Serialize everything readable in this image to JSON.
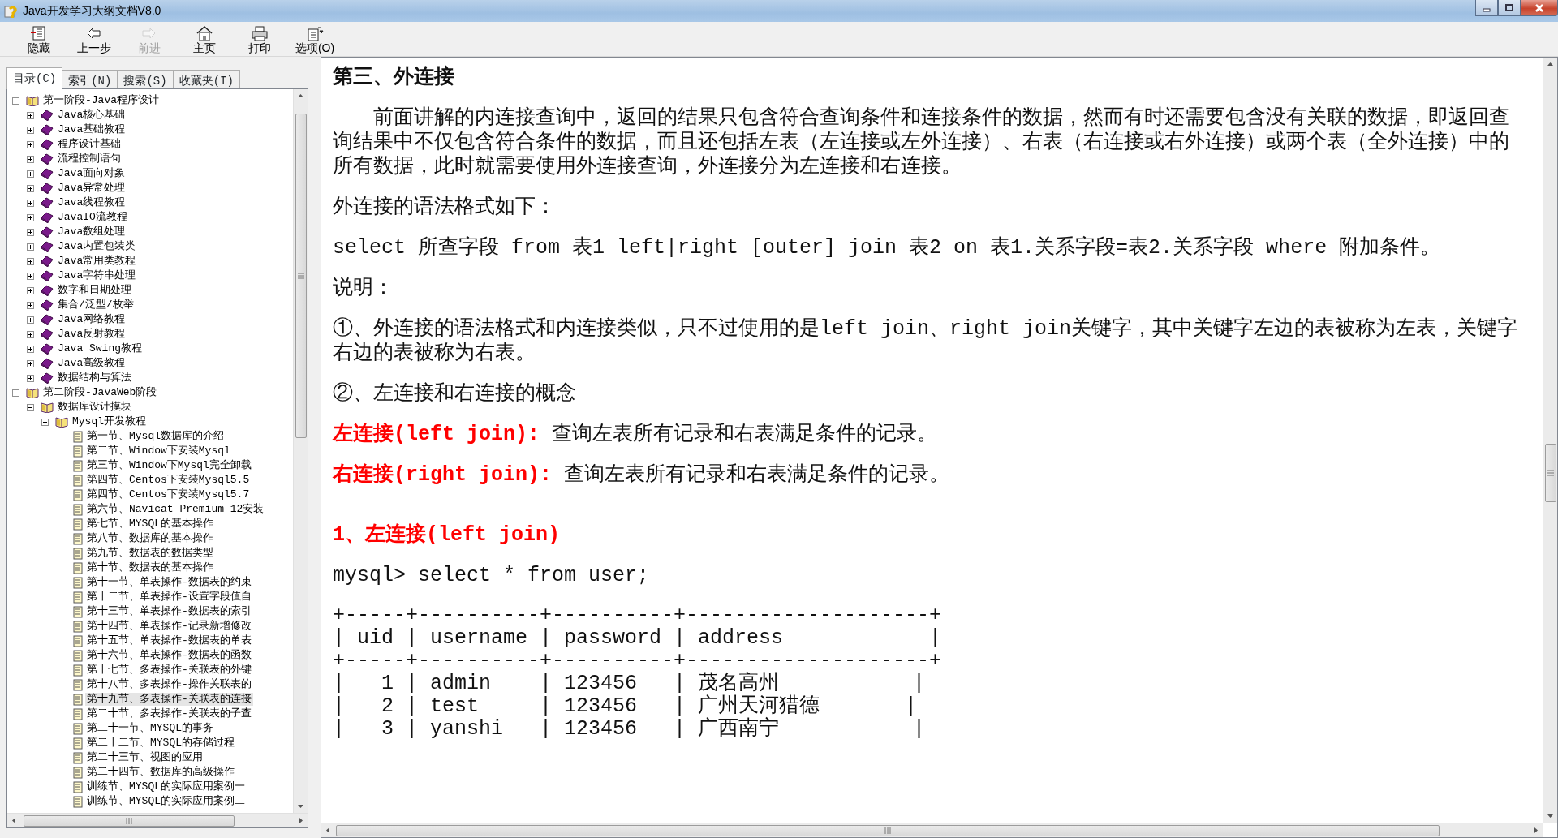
{
  "window": {
    "title": "Java开发学习大纲文档V8.0"
  },
  "toolbar": [
    {
      "label": "隐藏",
      "kind": "hide",
      "disabled": false
    },
    {
      "label": "上一步",
      "kind": "back",
      "disabled": false
    },
    {
      "label": "前进",
      "kind": "forward",
      "disabled": true
    },
    {
      "label": "主页",
      "kind": "home",
      "disabled": false
    },
    {
      "label": "打印",
      "kind": "print",
      "disabled": false
    },
    {
      "label": "选项(O)",
      "kind": "options",
      "disabled": false
    }
  ],
  "tabs": [
    {
      "label": "目录(C)",
      "selected": true
    },
    {
      "label": "索引(N)",
      "selected": false
    },
    {
      "label": "搜索(S)",
      "selected": false
    },
    {
      "label": "收藏夹(I)",
      "selected": false
    }
  ],
  "tree": [
    {
      "kind": "book",
      "label": "第一阶段-Java程序设计",
      "expanded": true,
      "children": [
        {
          "kind": "book",
          "label": "Java核心基础",
          "expanded": false
        },
        {
          "kind": "book",
          "label": "Java基础教程",
          "expanded": false
        },
        {
          "kind": "book",
          "label": "程序设计基础",
          "expanded": false
        },
        {
          "kind": "book",
          "label": "流程控制语句",
          "expanded": false
        },
        {
          "kind": "book",
          "label": "Java面向对象",
          "expanded": false
        },
        {
          "kind": "book",
          "label": "Java异常处理",
          "expanded": false
        },
        {
          "kind": "book",
          "label": "Java线程教程",
          "expanded": false
        },
        {
          "kind": "book",
          "label": "JavaIO流教程",
          "expanded": false
        },
        {
          "kind": "book",
          "label": "Java数组处理",
          "expanded": false
        },
        {
          "kind": "book",
          "label": "Java内置包装类",
          "expanded": false
        },
        {
          "kind": "book",
          "label": "Java常用类教程",
          "expanded": false
        },
        {
          "kind": "book",
          "label": "Java字符串处理",
          "expanded": false
        },
        {
          "kind": "book",
          "label": "数字和日期处理",
          "expanded": false
        },
        {
          "kind": "book",
          "label": "集合/泛型/枚举",
          "expanded": false
        },
        {
          "kind": "book",
          "label": "Java网络教程",
          "expanded": false
        },
        {
          "kind": "book",
          "label": "Java反射教程",
          "expanded": false
        },
        {
          "kind": "book",
          "label": "Java Swing教程",
          "expanded": false
        },
        {
          "kind": "book",
          "label": "Java高级教程",
          "expanded": false
        },
        {
          "kind": "book",
          "label": "数据结构与算法",
          "expanded": false
        }
      ]
    },
    {
      "kind": "book",
      "label": "第二阶段-JavaWeb阶段",
      "expanded": true,
      "children": [
        {
          "kind": "book",
          "label": "数据库设计摸块",
          "expanded": true,
          "children": [
            {
              "kind": "book",
              "label": "Mysql开发教程",
              "expanded": true,
              "children": [
                {
                  "kind": "page",
                  "label": "第一节、Mysql数据库的介绍",
                  "selected": false
                },
                {
                  "kind": "page",
                  "label": "第二节、Window下安装Mysql",
                  "selected": false
                },
                {
                  "kind": "page",
                  "label": "第三节、Window下Mysql完全卸载",
                  "selected": false
                },
                {
                  "kind": "page",
                  "label": "第四节、Centos下安装Mysql5.5",
                  "selected": false
                },
                {
                  "kind": "page",
                  "label": "第四节、Centos下安装Mysql5.7",
                  "selected": false
                },
                {
                  "kind": "page",
                  "label": "第六节、Navicat Premium 12安装",
                  "selected": false
                },
                {
                  "kind": "page",
                  "label": "第七节、MYSQL的基本操作",
                  "selected": false
                },
                {
                  "kind": "page",
                  "label": "第八节、数据库的基本操作",
                  "selected": false
                },
                {
                  "kind": "page",
                  "label": "第九节、数据表的数据类型",
                  "selected": false
                },
                {
                  "kind": "page",
                  "label": "第十节、数据表的基本操作",
                  "selected": false
                },
                {
                  "kind": "page",
                  "label": "第十一节、单表操作-数据表的约束",
                  "selected": false
                },
                {
                  "kind": "page",
                  "label": "第十二节、单表操作-设置字段值自",
                  "selected": false
                },
                {
                  "kind": "page",
                  "label": "第十三节、单表操作-数据表的索引",
                  "selected": false
                },
                {
                  "kind": "page",
                  "label": "第十四节、单表操作-记录新增修改",
                  "selected": false
                },
                {
                  "kind": "page",
                  "label": "第十五节、单表操作-数据表的单表",
                  "selected": false
                },
                {
                  "kind": "page",
                  "label": "第十六节、单表操作-数据表的函数",
                  "selected": false
                },
                {
                  "kind": "page",
                  "label": "第十七节、多表操作-关联表的外键",
                  "selected": false
                },
                {
                  "kind": "page",
                  "label": "第十八节、多表操作-操作关联表的",
                  "selected": false
                },
                {
                  "kind": "page",
                  "label": "第十九节、多表操作-关联表的连接",
                  "selected": true
                },
                {
                  "kind": "page",
                  "label": "第二十节、多表操作-关联表的子查",
                  "selected": false
                },
                {
                  "kind": "page",
                  "label": "第二十一节、MYSQL的事务",
                  "selected": false
                },
                {
                  "kind": "page",
                  "label": "第二十二节、MYSQL的存储过程",
                  "selected": false
                },
                {
                  "kind": "page",
                  "label": "第二十三节、视图的应用",
                  "selected": false
                },
                {
                  "kind": "page",
                  "label": "第二十四节、数据库的高级操作",
                  "selected": false
                },
                {
                  "kind": "page",
                  "label": "训练节、MYSQL的实际应用案例一",
                  "selected": false
                },
                {
                  "kind": "page",
                  "label": "训练节、MYSQL的实际应用案例二",
                  "selected": false
                }
              ]
            }
          ]
        }
      ]
    }
  ],
  "content": [
    {
      "kind": "heading",
      "text": "第三、外连接"
    },
    {
      "kind": "intro",
      "text": "前面讲解的内连接查询中，返回的结果只包含符合查询条件和连接条件的数据，然而有时还需要包含没有关联的数据，即返回查询结果中不仅包含符合条件的数据，而且还包括左表（左连接或左外连接）、右表（右连接或右外连接）或两个表（全外连接）中的所有数据，此时就需要使用外连接查询，外连接分为左连接和右连接。"
    },
    {
      "kind": "para",
      "text": "外连接的语法格式如下："
    },
    {
      "kind": "para",
      "text": "select 所查字段 from 表1 left|right [outer] join 表2 on 表1.关系字段=表2.关系字段 where 附加条件。"
    },
    {
      "kind": "para",
      "text": "说明："
    },
    {
      "kind": "para",
      "text": "①、外连接的语法格式和内连接类似，只不过使用的是left join、right join关键字，其中关键字左边的表被称为左表，关键字右边的表被称为右表。"
    },
    {
      "kind": "para",
      "text": "②、左连接和右连接的概念"
    },
    {
      "kind": "term",
      "label": "左连接(left join):",
      "text": "查询左表所有记录和右表满足条件的记录。"
    },
    {
      "kind": "term",
      "label": "右连接(right join):",
      "text": "查询左表所有记录和右表满足条件的记录。"
    },
    {
      "kind": "subheading",
      "text": "1、左连接(left join)"
    },
    {
      "kind": "para",
      "text": "mysql> select * from user;"
    },
    {
      "kind": "ascii",
      "lines": [
        "+-----+----------+----------+--------------------+",
        "| uid | username | password | address            |",
        "+-----+----------+----------+--------------------+",
        "|   1 | admin    | 123456   | 茂名高州           |",
        "|   2 | test     | 123456   | 广州天河猎德       |",
        "|   3 | yanshi   | 123456   | 广西南宁           |"
      ]
    }
  ]
}
